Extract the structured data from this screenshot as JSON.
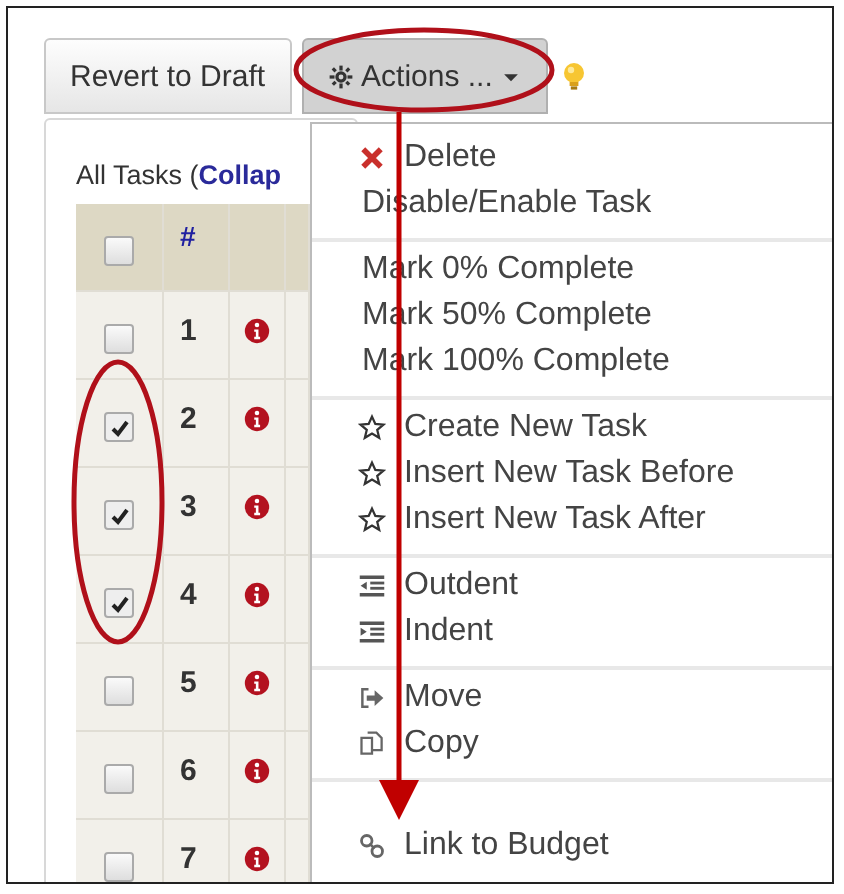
{
  "toolbar": {
    "buttons": [
      {
        "label": "Revert to Draft",
        "kind": "plain",
        "pressed": false
      },
      {
        "label": "Actions ...",
        "kind": "dropdown",
        "pressed": true
      }
    ]
  },
  "tasks": {
    "label": "All Tasks (",
    "link": "Collap",
    "columns": [
      {
        "label": "#"
      }
    ],
    "header_checked": false,
    "rows": [
      {
        "number": "1",
        "checked": false
      },
      {
        "number": "2",
        "checked": true
      },
      {
        "number": "3",
        "checked": true
      },
      {
        "number": "4",
        "checked": true
      },
      {
        "number": "5",
        "checked": false
      },
      {
        "number": "6",
        "checked": false
      },
      {
        "number": "7",
        "checked": false
      }
    ]
  },
  "menu": {
    "groups": [
      {
        "items": [
          {
            "label": "Delete",
            "kind": "delete"
          },
          {
            "label": "Disable/Enable Task",
            "kind": "plain"
          }
        ]
      },
      {
        "items": [
          {
            "label": "Mark 0% Complete",
            "kind": "plain"
          },
          {
            "label": "Mark 50% Complete",
            "kind": "plain"
          },
          {
            "label": "Mark 100% Complete",
            "kind": "plain"
          }
        ]
      },
      {
        "items": [
          {
            "label": "Create New Task",
            "kind": "star"
          },
          {
            "label": "Insert New Task Before",
            "kind": "star"
          },
          {
            "label": "Insert New Task After",
            "kind": "star"
          }
        ]
      },
      {
        "items": [
          {
            "label": "Outdent",
            "kind": "outdent"
          },
          {
            "label": "Indent",
            "kind": "indent"
          }
        ]
      },
      {
        "items": [
          {
            "label": "Move",
            "kind": "move"
          },
          {
            "label": "Copy",
            "kind": "copy"
          }
        ]
      },
      {
        "items": [
          {
            "label": "Link to Budget",
            "kind": "link"
          }
        ]
      }
    ]
  }
}
